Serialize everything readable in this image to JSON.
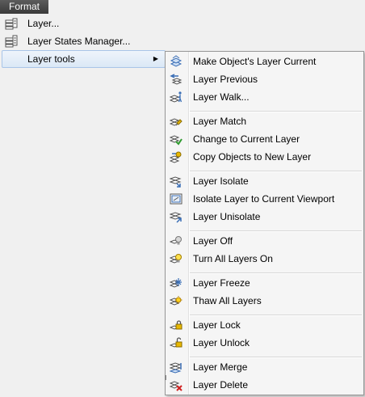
{
  "menubar": {
    "format_label": "Format"
  },
  "main_menu": {
    "items": [
      {
        "label": "Layer...",
        "icon": "layer-properties-icon"
      },
      {
        "label": "Layer States Manager...",
        "icon": "layer-states-icon"
      },
      {
        "label": "Layer tools",
        "icon": "none",
        "submenu_arrow": "▶"
      }
    ]
  },
  "submenu": {
    "items": [
      {
        "label": "Make Object's Layer Current",
        "icon": "make-current-icon"
      },
      {
        "label": "Layer Previous",
        "icon": "layer-previous-icon"
      },
      {
        "label": "Layer Walk...",
        "icon": "layer-walk-icon"
      },
      {
        "label": "Layer Match",
        "icon": "layer-match-icon"
      },
      {
        "label": "Change to Current Layer",
        "icon": "change-to-current-icon"
      },
      {
        "label": "Copy Objects to New Layer",
        "icon": "copy-to-layer-icon"
      },
      {
        "label": "Layer Isolate",
        "icon": "layer-isolate-icon"
      },
      {
        "label": "Isolate Layer to Current Viewport",
        "icon": "isolate-viewport-icon"
      },
      {
        "label": "Layer Unisolate",
        "icon": "layer-unisolate-icon"
      },
      {
        "label": "Layer Off",
        "icon": "layer-off-icon"
      },
      {
        "label": "Turn All Layers On",
        "icon": "all-layers-on-icon"
      },
      {
        "label": "Layer Freeze",
        "icon": "layer-freeze-icon"
      },
      {
        "label": "Thaw All Layers",
        "icon": "thaw-all-icon"
      },
      {
        "label": "Layer Lock",
        "icon": "layer-lock-icon"
      },
      {
        "label": "Layer Unlock",
        "icon": "layer-unlock-icon"
      },
      {
        "label": "Layer Merge",
        "icon": "layer-merge-icon"
      },
      {
        "label": "Layer Delete",
        "icon": "layer-delete-icon"
      }
    ]
  },
  "colors": {
    "menubar_bg": "#4a4a4a",
    "highlight_border": "#a9c5e8",
    "menu_bg": "#f5f5f5",
    "icon_blue": "#3b6fb6",
    "icon_yellow": "#e8b800",
    "icon_green": "#2e9a2e",
    "icon_red": "#d02020"
  }
}
